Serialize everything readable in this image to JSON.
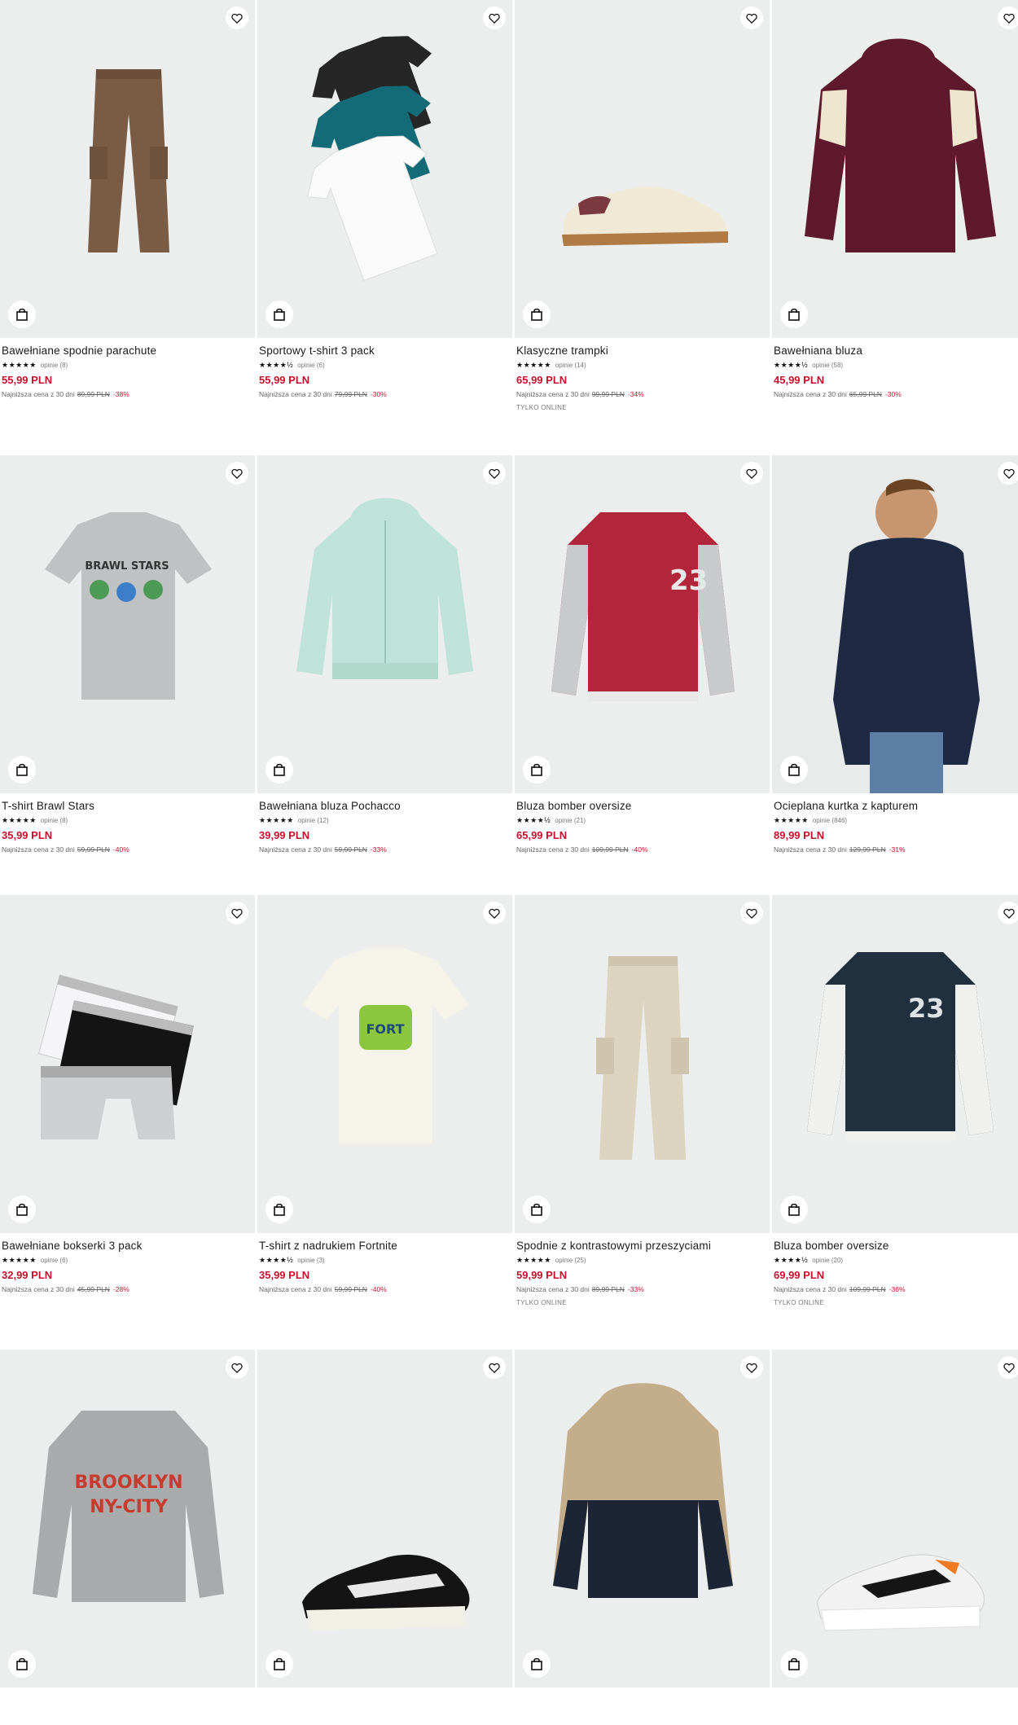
{
  "colors": {
    "accent": "#c8102e",
    "tile_bg": "#eceded"
  },
  "icons": {
    "favorite": "heart-icon",
    "cart": "bag-icon",
    "star": "star-icon"
  },
  "products": [
    {
      "name": "Bawełniane spodnie parachute",
      "stars": "★★★★★",
      "reviews": "opinie (8)",
      "price": "55,99 PLN",
      "lowest_label": "Najniższa cena z 30 dni",
      "old_price": "89,99 PLN",
      "discount": "-38%",
      "online": "",
      "art": "pants-brown"
    },
    {
      "name": "Sportowy t-shirt 3 pack",
      "stars": "★★★★½",
      "reviews": "opinie (6)",
      "price": "55,99 PLN",
      "lowest_label": "Najniższa cena z 30 dni",
      "old_price": "79,99 PLN",
      "discount": "-30%",
      "online": "",
      "art": "tshirt-pack"
    },
    {
      "name": "Klasyczne trampki",
      "stars": "★★★★★",
      "reviews": "opinie (14)",
      "price": "65,99 PLN",
      "lowest_label": "Najniższa cena z 30 dni",
      "old_price": "99,99 PLN",
      "discount": "-34%",
      "online": "TYLKO ONLINE",
      "art": "sneaker-cream"
    },
    {
      "name": "Bawełniana bluza",
      "stars": "★★★★½",
      "reviews": "opinie (58)",
      "price": "45,99 PLN",
      "lowest_label": "Najniższa cena z 30 dni",
      "old_price": "65,99 PLN",
      "discount": "-30%",
      "online": "",
      "art": "hoodie-maroon"
    },
    {
      "name": "T-shirt Brawl Stars",
      "stars": "★★★★★",
      "reviews": "opinie (8)",
      "price": "35,99 PLN",
      "lowest_label": "Najniższa cena z 30 dni",
      "old_price": "59,99 PLN",
      "discount": "-40%",
      "online": "",
      "art": "tshirt-grey"
    },
    {
      "name": "Bawełniana bluza Pochacco",
      "stars": "★★★★★",
      "reviews": "opinie (12)",
      "price": "39,99 PLN",
      "lowest_label": "Najniższa cena z 30 dni",
      "old_price": "59,99 PLN",
      "discount": "-33%",
      "online": "",
      "art": "hoodie-mint"
    },
    {
      "name": "Bluza bomber oversize",
      "stars": "★★★★½",
      "reviews": "opinie (21)",
      "price": "65,99 PLN",
      "lowest_label": "Najniższa cena z 30 dni",
      "old_price": "109,99 PLN",
      "discount": "-40%",
      "online": "",
      "art": "bomber-red"
    },
    {
      "name": "Ocieplana kurtka z kapturem",
      "stars": "★★★★★",
      "reviews": "opinie (846)",
      "price": "89,99 PLN",
      "lowest_label": "Najniższa cena z 30 dni",
      "old_price": "129,99 PLN",
      "discount": "-31%",
      "online": "",
      "art": "puffer-navy"
    },
    {
      "name": "Bawełniane bokserki 3 pack",
      "stars": "★★★★★",
      "reviews": "opinie (6)",
      "price": "32,99 PLN",
      "lowest_label": "Najniższa cena z 30 dni",
      "old_price": "45,99 PLN",
      "discount": "-28%",
      "online": "",
      "art": "boxers"
    },
    {
      "name": "T-shirt z nadrukiem Fortnite",
      "stars": "★★★★½",
      "reviews": "opinie (3)",
      "price": "35,99 PLN",
      "lowest_label": "Najniższa cena z 30 dni",
      "old_price": "59,99 PLN",
      "discount": "-40%",
      "online": "",
      "art": "tshirt-cream"
    },
    {
      "name": "Spodnie z kontrastowymi przeszyciami",
      "stars": "★★★★★",
      "reviews": "opinie (25)",
      "price": "59,99 PLN",
      "lowest_label": "Najniższa cena z 30 dni",
      "old_price": "89,99 PLN",
      "discount": "-33%",
      "online": "TYLKO ONLINE",
      "art": "pants-beige"
    },
    {
      "name": "Bluza bomber oversize",
      "stars": "★★★★½",
      "reviews": "opinie (20)",
      "price": "69,99 PLN",
      "lowest_label": "Najniższa cena z 30 dni",
      "old_price": "109,99 PLN",
      "discount": "-36%",
      "online": "TYLKO ONLINE",
      "art": "bomber-navy"
    },
    {
      "name": "",
      "stars": "",
      "reviews": "",
      "price": "",
      "lowest_label": "",
      "old_price": "",
      "discount": "",
      "online": "",
      "art": "sweater-grey"
    },
    {
      "name": "",
      "stars": "",
      "reviews": "",
      "price": "",
      "lowest_label": "",
      "old_price": "",
      "discount": "",
      "online": "",
      "art": "sneaker-black"
    },
    {
      "name": "",
      "stars": "",
      "reviews": "",
      "price": "",
      "lowest_label": "",
      "old_price": "",
      "discount": "",
      "online": "",
      "art": "jacket-beige-navy"
    },
    {
      "name": "",
      "stars": "",
      "reviews": "",
      "price": "",
      "lowest_label": "",
      "old_price": "",
      "discount": "",
      "online": "",
      "art": "sneaker-orange"
    }
  ]
}
